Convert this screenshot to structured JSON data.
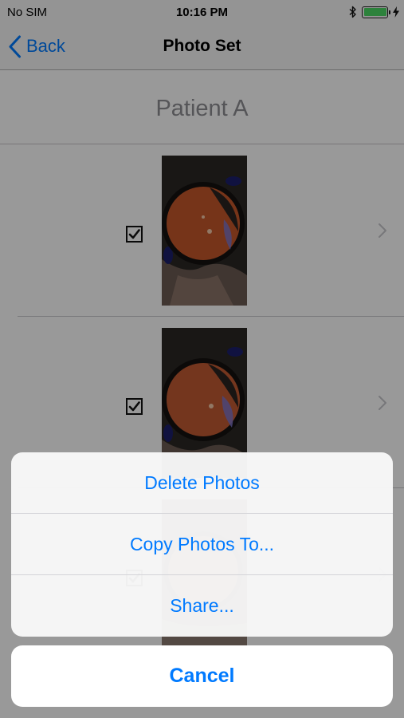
{
  "status_bar": {
    "carrier": "No SIM",
    "time": "10:16 PM",
    "battery_level": 1.0,
    "battery_color": "#4cd964"
  },
  "nav": {
    "back_label": "Back",
    "title": "Photo Set",
    "accent_color": "#007aff"
  },
  "patient": {
    "name": "Patient A"
  },
  "photos": [
    {
      "checked": true,
      "icon": "chevron-right-icon"
    },
    {
      "checked": true,
      "icon": "chevron-right-icon"
    },
    {
      "checked": true,
      "icon": "chevron-right-icon"
    }
  ],
  "action_sheet": {
    "items": [
      {
        "label": "Delete Photos"
      },
      {
        "label": "Copy Photos To..."
      },
      {
        "label": "Share..."
      }
    ],
    "cancel_label": "Cancel"
  }
}
